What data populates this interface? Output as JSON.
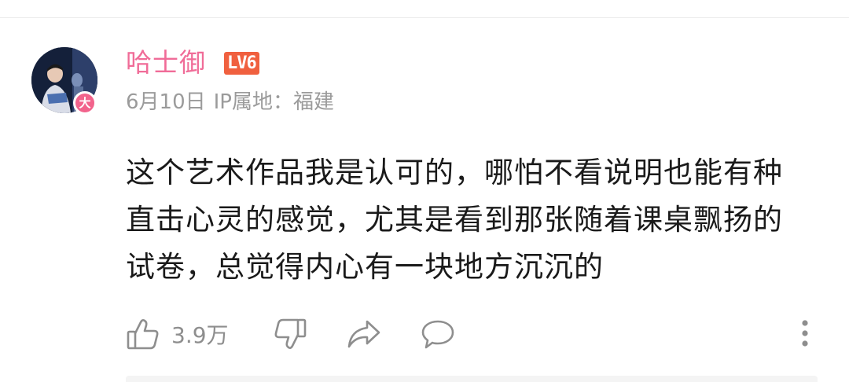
{
  "comment": {
    "author": {
      "name": "哈士御",
      "level": "LV6",
      "avatar_badge": "大"
    },
    "date": "6月10日",
    "ip_location": "IP属地：福建",
    "text": "这个艺术作品我是认可的，哪怕不看说明也能有种直击心灵的感觉，尤其是看到那张随着课桌飘扬的试卷，总觉得内心有一块地方沉沉的",
    "actions": {
      "like_count": "3.9万",
      "like_icon": "thumbs-up-icon",
      "dislike_icon": "thumbs-down-icon",
      "share_icon": "share-icon",
      "reply_icon": "comment-bubble-icon",
      "more_icon": "more-vertical-icon"
    }
  },
  "colors": {
    "username": "#f06c98",
    "level_badge": "#f0603f",
    "meta_text": "#9b9b9b",
    "body_text": "#1a1a1a",
    "icon": "#8e8e8e",
    "avatar_badge": "#f2638c"
  }
}
